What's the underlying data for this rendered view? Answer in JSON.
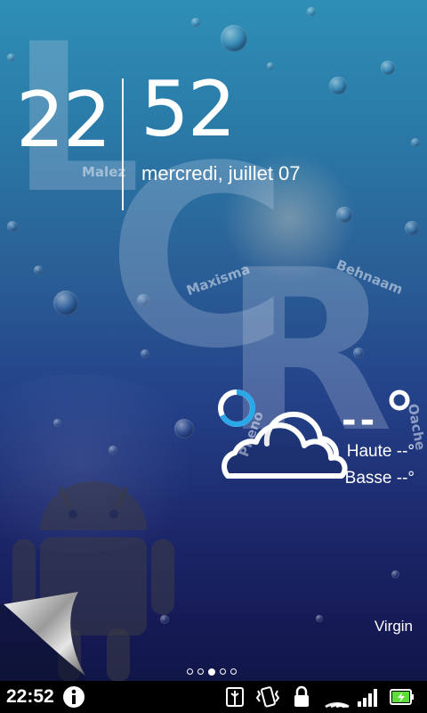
{
  "clock": {
    "hours": "22",
    "minutes": "52",
    "date": "mercredi, juillet 07"
  },
  "weather": {
    "temperature": "--",
    "unit_symbol": "°",
    "high": "Haute --°",
    "low": "Basse --°",
    "condition_icon": "cloud-icon",
    "loading_icon": "refresh-spinner-icon"
  },
  "carrier": "Virgin",
  "watermark": {
    "letters": [
      "L",
      "C",
      "R"
    ],
    "names": [
      "Malez",
      "Maxisma",
      "Behnaam",
      "Pheno",
      "Oache"
    ]
  },
  "home_pages": {
    "count": 5,
    "active_index": 2
  },
  "status_bar": {
    "time": "22:52",
    "icons": [
      "info-icon",
      "usb-debug-icon",
      "vibrate-icon",
      "lock-icon",
      "wifi-icon",
      "signal-icon",
      "battery-charging-icon"
    ]
  },
  "colors": {
    "accent_ring": "#2aa8e8",
    "battery": "#5ddc3a"
  }
}
